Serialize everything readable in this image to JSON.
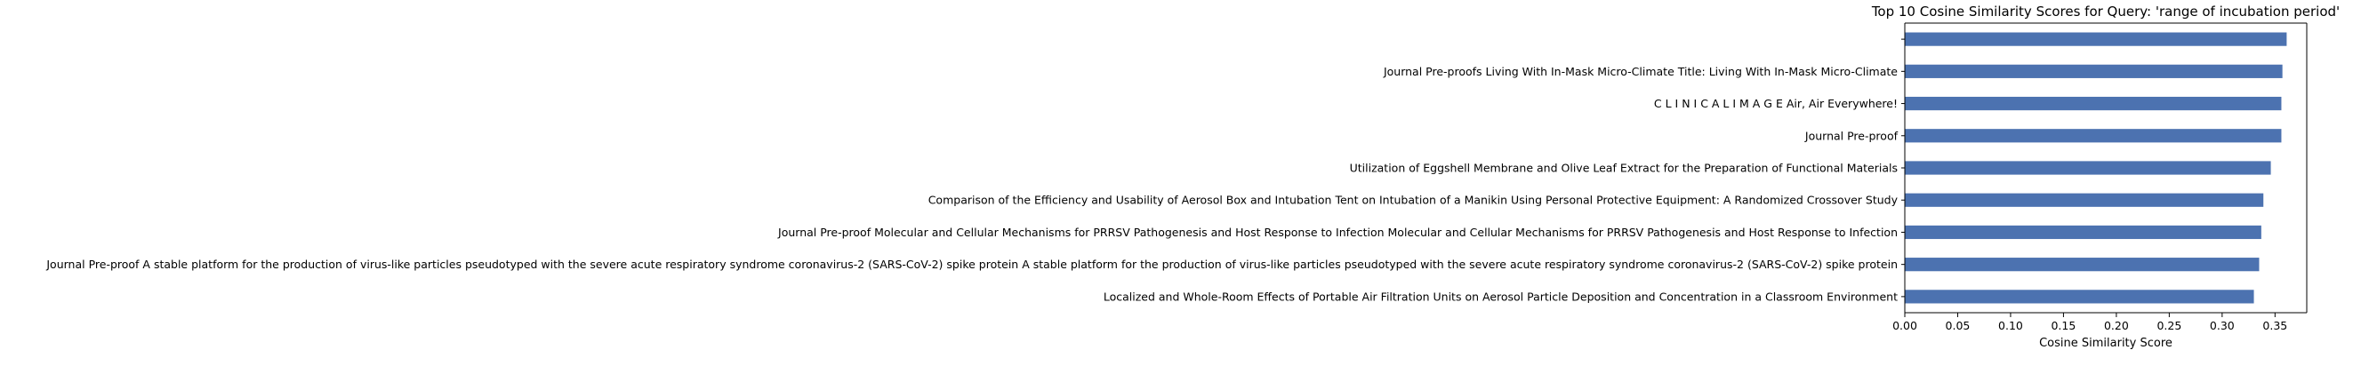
{
  "chart_data": {
    "type": "bar",
    "orientation": "horizontal",
    "title": "Top 10 Cosine Similarity Scores for Query: 'range of incubation period'",
    "xlabel": "Cosine Similarity Score",
    "ylabel": "",
    "xlim": [
      0,
      0.38
    ],
    "xticks": [
      0.0,
      0.05,
      0.1,
      0.15,
      0.2,
      0.25,
      0.3,
      0.35
    ],
    "xtick_labels": [
      "0.00",
      "0.05",
      "0.10",
      "0.15",
      "0.20",
      "0.25",
      "0.30",
      "0.35"
    ],
    "grid": false,
    "bar_color": "#4c72b0",
    "categories": [
      "",
      "Journal Pre-proofs Living With In-Mask Micro-Climate Title: Living With In-Mask Micro-Climate",
      "C L I N I C A L I M A G E Air, Air Everywhere!",
      "Journal Pre-proof",
      "Utilization of Eggshell Membrane and Olive Leaf Extract for the Preparation of Functional Materials",
      "Comparison of the Efficiency and Usability of Aerosol Box and Intubation Tent on Intubation of a Manikin Using Personal Protective Equipment: A Randomized Crossover Study",
      "Journal Pre-proof Molecular and Cellular Mechanisms for PRRSV Pathogenesis and Host Response to Infection Molecular and Cellular Mechanisms for PRRSV Pathogenesis and Host Response to Infection",
      "Journal Pre-proof A stable platform for the production of virus-like particles pseudotyped with the severe acute respiratory syndrome coronavirus-2 (SARS-CoV-2) spike protein A stable platform for the production of virus-like particles pseudotyped with the severe acute respiratory syndrome coronavirus-2 (SARS-CoV-2) spike protein",
      "Localized and Whole-Room Effects of Portable Air Filtration Units on Aerosol Particle Deposition and Concentration in a Classroom Environment"
    ],
    "values": [
      0.361,
      0.357,
      0.356,
      0.356,
      0.346,
      0.339,
      0.337,
      0.335,
      0.33
    ]
  }
}
